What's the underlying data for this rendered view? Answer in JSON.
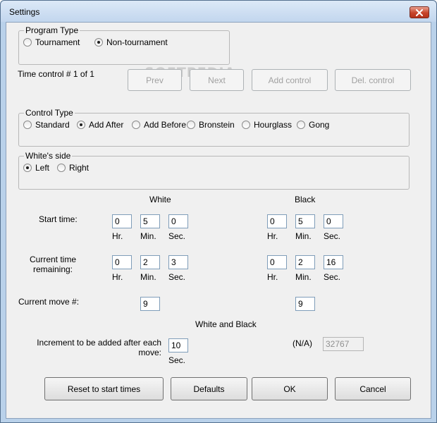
{
  "window": {
    "title": "Settings"
  },
  "program_type": {
    "legend": "Program Type",
    "options": [
      {
        "label": "Tournament",
        "selected": false
      },
      {
        "label": "Non-tournament",
        "selected": true
      }
    ]
  },
  "time_control": {
    "label": "Time control # 1 of 1",
    "prev": "Prev",
    "next": "Next",
    "add": "Add control",
    "del": "Del. control"
  },
  "watermark": "SOFTPEDIA",
  "control_type": {
    "legend": "Control Type",
    "options": [
      {
        "label": "Standard",
        "selected": false
      },
      {
        "label": "Add After",
        "selected": true
      },
      {
        "label": "Add Before",
        "selected": false
      },
      {
        "label": "Bronstein",
        "selected": false
      },
      {
        "label": "Hourglass",
        "selected": false
      },
      {
        "label": "Gong",
        "selected": false
      }
    ]
  },
  "whites_side": {
    "legend": "White's side",
    "options": [
      {
        "label": "Left",
        "selected": true
      },
      {
        "label": "Right",
        "selected": false
      }
    ]
  },
  "headers": {
    "white": "White",
    "black": "Black",
    "white_and_black": "White and Black"
  },
  "rows": {
    "start_time": "Start time:",
    "current_time": "Current time remaining:",
    "current_move": "Current move #:",
    "increment": "Increment to be added after each move:"
  },
  "units": {
    "hr": "Hr.",
    "min": "Min.",
    "sec": "Sec."
  },
  "white_start": {
    "hr": "0",
    "min": "5",
    "sec": "0"
  },
  "black_start": {
    "hr": "0",
    "min": "5",
    "sec": "0"
  },
  "white_current": {
    "hr": "0",
    "min": "2",
    "sec": "3"
  },
  "black_current": {
    "hr": "0",
    "min": "2",
    "sec": "16"
  },
  "white_move": "9",
  "black_move": "9",
  "increment": {
    "value": "10",
    "unit": "Sec.",
    "na_label": "(N/A)",
    "na_value": "32767"
  },
  "buttons": {
    "reset": "Reset to start times",
    "defaults": "Defaults",
    "ok": "OK",
    "cancel": "Cancel"
  }
}
